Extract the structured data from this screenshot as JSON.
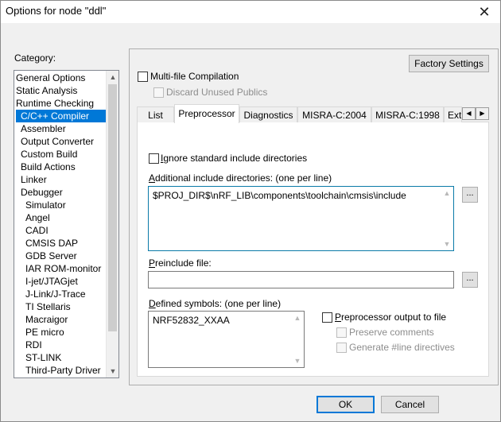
{
  "window": {
    "title": "Options for node \"ddl\""
  },
  "category": {
    "label": "Category:",
    "items": [
      "General Options",
      "Static Analysis",
      "Runtime Checking",
      "C/C++ Compiler",
      "Assembler",
      "Output Converter",
      "Custom Build",
      "Build Actions",
      "Linker",
      "Debugger",
      "Simulator",
      "Angel",
      "CADI",
      "CMSIS DAP",
      "GDB Server",
      "IAR ROM-monitor",
      "I-jet/JTAGjet",
      "J-Link/J-Trace",
      "TI Stellaris",
      "Macraigor",
      "PE micro",
      "RDI",
      "ST-LINK",
      "Third-Party Driver"
    ],
    "selected": "C/C++ Compiler"
  },
  "factory_settings": "Factory Settings",
  "multi_file": {
    "label": "Multi-file Compilation",
    "checked": false
  },
  "discard_unused": {
    "label": "Discard Unused Publics",
    "checked": false,
    "enabled": false
  },
  "tabs": [
    "List",
    "Preprocessor",
    "Diagnostics",
    "MISRA-C:2004",
    "MISRA-C:1998",
    "Ext"
  ],
  "active_tab": "Preprocessor",
  "preprocessor": {
    "ignore_std_prefix": "I",
    "ignore_std_rest": "gnore standard include directories",
    "additional_label_prefix": "A",
    "additional_label_rest": "dditional include directories: (one per line)",
    "additional_value": "$PROJ_DIR$\\nRF_LIB\\components\\toolchain\\cmsis\\include",
    "preinclude_label_prefix": "P",
    "preinclude_label_rest": "reinclude file:",
    "preinclude_value": "",
    "defined_label_prefix": "D",
    "defined_label_rest": "efined symbols: (one per line)",
    "defined_value": "NRF52832_XXAA",
    "pp_output_prefix": "P",
    "pp_output_rest": "reprocessor output to file",
    "preserve_comments": "Preserve comments",
    "generate_line": "Generate #line directives",
    "browse": "..."
  },
  "buttons": {
    "ok": "OK",
    "cancel": "Cancel"
  },
  "icons": {
    "close": "✕",
    "scroll_up": "▲",
    "scroll_down": "▼",
    "tab_left": "◀",
    "tab_right": "▶"
  },
  "colors": {
    "selection": "#0078d7",
    "focus_border": "#0a7aa8"
  }
}
